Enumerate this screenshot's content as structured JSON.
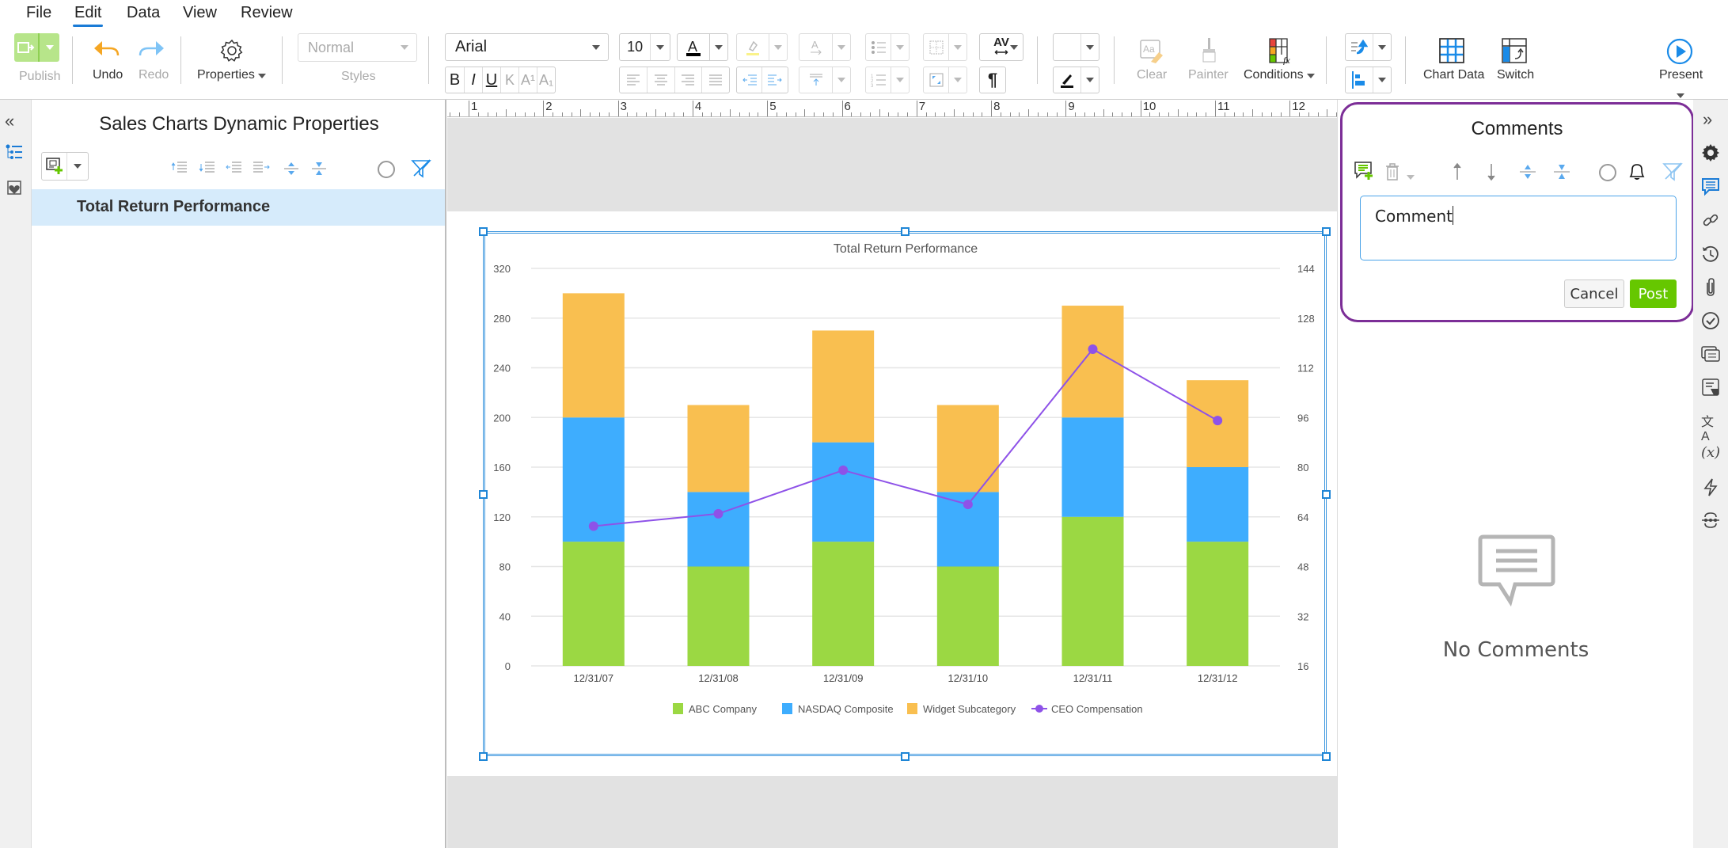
{
  "menu": [
    "File",
    "Edit",
    "Data",
    "View",
    "Review"
  ],
  "menu_active": "Edit",
  "ribbon": {
    "publish": "Publish",
    "undo": "Undo",
    "redo": "Redo",
    "properties": "Properties",
    "style_value": "Normal",
    "styles": "Styles",
    "font_family": "Arial",
    "font_size": "10",
    "clear": "Clear",
    "painter": "Painter",
    "conditions": "Conditions",
    "chart_data": "Chart Data",
    "switch": "Switch",
    "present": "Present",
    "format_buttons": [
      "B",
      "I",
      "U"
    ],
    "pilcrow": "¶",
    "av": "AV"
  },
  "left_panel": {
    "title": "Sales Charts Dynamic Properties",
    "selected_item": "Total Return Performance"
  },
  "ruler": {
    "numbers": [
      "1",
      "2",
      "3",
      "4",
      "5",
      "6",
      "7",
      "8",
      "9",
      "10",
      "11",
      "12"
    ]
  },
  "comments": {
    "title": "Comments",
    "input_value": "Comment",
    "cancel": "Cancel",
    "post": "Post",
    "empty_state": "No Comments"
  },
  "colors": {
    "abc": "#9bd843",
    "nasdaq": "#3eadfe",
    "widget": "#f9bf50",
    "ceo": "#8e52e8",
    "accent": "#1a7bd6",
    "post": "#66c700",
    "comments_border": "#7c2e97"
  },
  "chart_data": {
    "type": "bar",
    "stacked": true,
    "title": "Total Return Performance",
    "categories": [
      "12/31/07",
      "12/31/08",
      "12/31/09",
      "12/31/10",
      "12/31/11",
      "12/31/12"
    ],
    "series": [
      {
        "name": "ABC Company",
        "type": "bar",
        "axis": "left",
        "values": [
          100,
          80,
          100,
          80,
          120,
          100
        ]
      },
      {
        "name": "NASDAQ Composite",
        "type": "bar",
        "axis": "left",
        "values": [
          100,
          60,
          80,
          60,
          80,
          60
        ]
      },
      {
        "name": "Widget Subcategory",
        "type": "bar",
        "axis": "left",
        "values": [
          100,
          70,
          90,
          70,
          90,
          70
        ]
      },
      {
        "name": "CEO Compensation",
        "type": "line",
        "axis": "right",
        "values": [
          61,
          65,
          79,
          68,
          118,
          95
        ]
      }
    ],
    "y_left": {
      "min": 0,
      "max": 320,
      "ticks": [
        0,
        40,
        80,
        120,
        160,
        200,
        240,
        280,
        320
      ]
    },
    "y_right": {
      "min": 16,
      "max": 144,
      "ticks": [
        16,
        32,
        48,
        64,
        80,
        96,
        112,
        128,
        144
      ]
    },
    "grid": true,
    "legend": "bottom"
  }
}
